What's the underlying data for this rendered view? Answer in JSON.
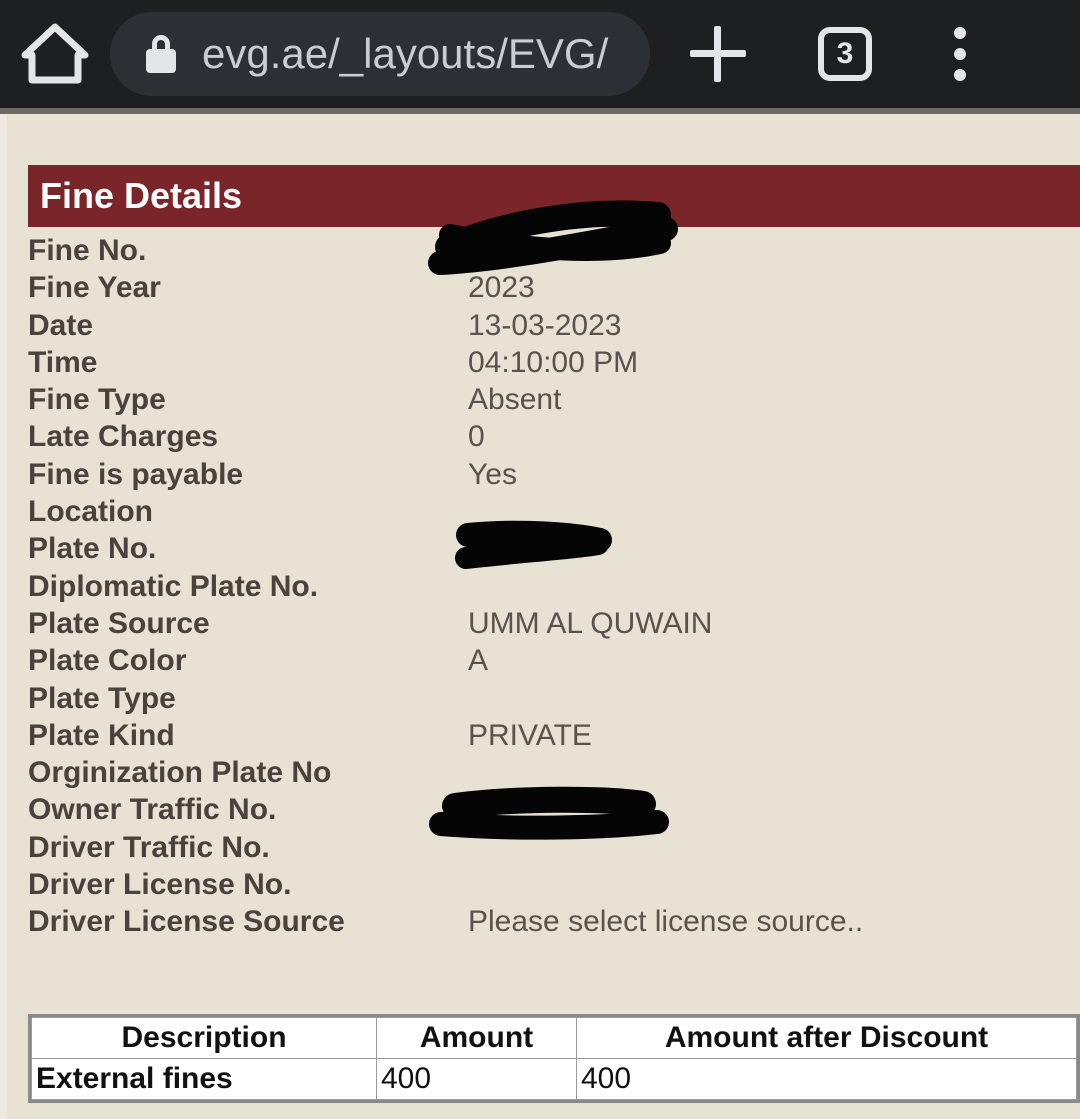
{
  "browser": {
    "home_icon": "home-icon",
    "lock_icon": "lock-icon",
    "url": "evg.ae/_layouts/EVG/",
    "new_tab_icon": "plus-icon",
    "tab_count": "3",
    "menu_icon": "overflow-menu-icon"
  },
  "page": {
    "section_title": "Fine Details",
    "accent_color": "#7A2529",
    "background_color": "#E8E2D5",
    "label_color": "#4A423C",
    "value_color": "#5A524C",
    "details": [
      {
        "label": "Fine No.",
        "value": "",
        "redacted": true
      },
      {
        "label": "Fine Year",
        "value": "2023",
        "redacted": false
      },
      {
        "label": "Date",
        "value": "13-03-2023",
        "redacted": false
      },
      {
        "label": "Time",
        "value": "04:10:00 PM",
        "redacted": false
      },
      {
        "label": "Fine Type",
        "value": "Absent",
        "redacted": false
      },
      {
        "label": "Late Charges",
        "value": "0",
        "redacted": false
      },
      {
        "label": "Fine is payable",
        "value": "Yes",
        "redacted": false
      },
      {
        "label": "Location",
        "value": "",
        "redacted": false
      },
      {
        "label": "Plate No.",
        "value": "",
        "redacted": true
      },
      {
        "label": "Diplomatic Plate No.",
        "value": "",
        "redacted": false
      },
      {
        "label": "Plate Source",
        "value": "UMM AL QUWAIN",
        "redacted": false
      },
      {
        "label": "Plate Color",
        "value": "A",
        "redacted": false
      },
      {
        "label": "Plate Type",
        "value": "",
        "redacted": false
      },
      {
        "label": "Plate Kind",
        "value": "PRIVATE",
        "redacted": false
      },
      {
        "label": "Orginization Plate No",
        "value": "",
        "redacted": false
      },
      {
        "label": "Owner Traffic No.",
        "value": "",
        "redacted": true
      },
      {
        "label": "Driver Traffic No.",
        "value": "",
        "redacted": false
      },
      {
        "label": "Driver License No.",
        "value": "",
        "redacted": false
      },
      {
        "label": "Driver License Source",
        "value": "Please select license source..",
        "redacted": false
      }
    ],
    "fines_table": {
      "headers": [
        "Description",
        "Amount",
        "Amount after Discount"
      ],
      "rows": [
        {
          "description": "External fines",
          "amount": "400",
          "amount_after_discount": "400"
        }
      ]
    }
  }
}
